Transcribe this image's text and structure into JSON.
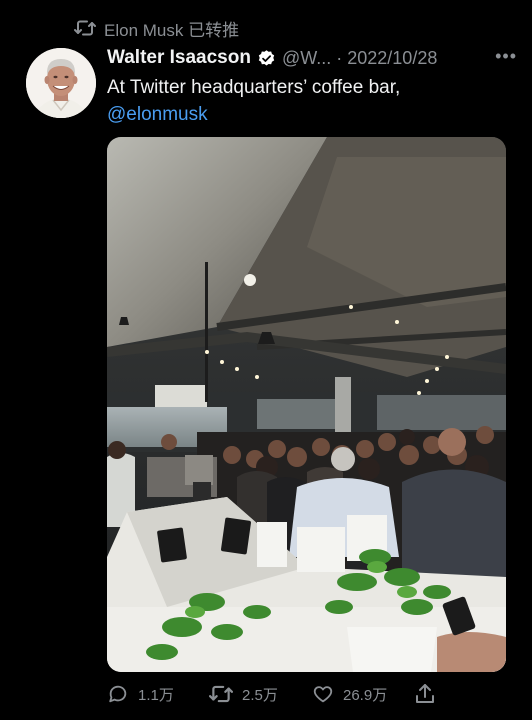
{
  "retweet": {
    "label": "Elon Musk 已转推",
    "icon": "retweet-icon"
  },
  "tweet": {
    "author_name": "Walter Isaacson",
    "verified_icon": "verified-badge-icon",
    "handle": "@W...",
    "separator": "·",
    "date": "2022/10/28",
    "more_icon": "more-options-icon",
    "more_glyph": "•••",
    "text": "At Twitter headquarters’ coffee bar,",
    "mention": "@elonmusk",
    "media_icon": "photo-image"
  },
  "actions": {
    "reply": {
      "icon": "reply-icon",
      "count": "1.1万"
    },
    "retweet": {
      "icon": "retweet-icon",
      "count": "2.5万"
    },
    "like": {
      "icon": "heart-icon",
      "count": "26.9万"
    },
    "share": {
      "icon": "share-icon"
    }
  },
  "colors": {
    "background": "#000000",
    "secondary_text": "#8b8f94",
    "link": "#4a9df0",
    "verified_badge": "#ffffff"
  }
}
